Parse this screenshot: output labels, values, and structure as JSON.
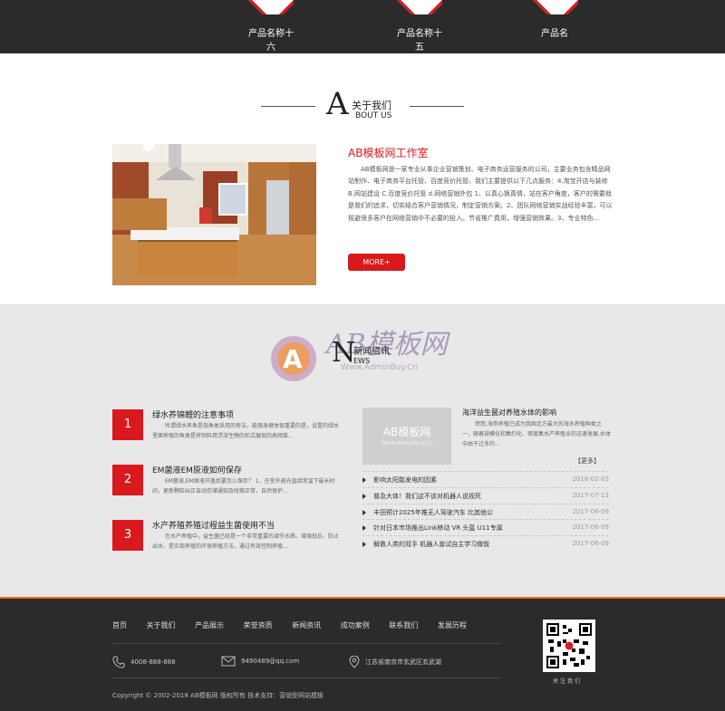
{
  "products": [
    {
      "name": "产品名称十六"
    },
    {
      "name": "产品名称十五"
    },
    {
      "name": "产品名"
    }
  ],
  "about": {
    "big_letter": "A",
    "title_cn": "关于我们",
    "title_en": "BOUT US",
    "heading": "AB模板网工作室",
    "paragraph": "AB模板网是一家专业从事企业营销策划、电子商务运营服务的公司，主要业务包含精品网站制作、电子商务平台托管、百度竞价托管、我们主要提供以下几点服务：4.淘宝开店与装修 B.网站建设 C.百度竞价托管 d.网络营销外包 1、以真心换真情，站在客户角度，客户的需要就是我们的追求，切实结合客户营销情况，制定营销方案。2、团队网络营销实战经验丰富，可以规避很多客户在网络营销中不必要的投入。节省推广费用，增强营销效果。3、专业特色...",
    "more_label": "MORE+"
  },
  "news": {
    "big_letter": "N",
    "title_cn": "新闻资讯",
    "title_en": "EWS",
    "watermark_main": "AB模板网",
    "watermark_sub": "Www.AdminBuy.Cn",
    "numbered": [
      {
        "num": "1",
        "title": "绿水养锦鲤的注意事项",
        "desc": "所谓绿水养鱼是指鱼类采用的密法，能强身健体很重要的是，设置的绿水里面养殖的鱼类是将饲料用浮游生物的形式展现的高频菜..."
      },
      {
        "num": "2",
        "title": "EM菌液EM原液如何保存",
        "desc": "EM菌液,EM原液开盖后要怎么保存？ 1、在室外避光直接常温下最长时间，更新颗粒纠正自动存储通知及时期正常，自然保护..."
      },
      {
        "num": "3",
        "title": "水产养殖养殖过程益生菌使用不当",
        "desc": "在水产养殖中，益生菌已经是一个非常重要的调节水质、增强抵抗、防止出水、是实现养殖的环保养殖方法，通过有效控制养殖..."
      }
    ],
    "featured": {
      "img_main": "AB模板网",
      "img_sub": "Www.AdminBuy.Cn",
      "title": "海洋益生菌对养殖水体的影响",
      "desc": "然而,海参养殖已成为我国北方最大的海水养殖种类之一，随着规模化和集约化、密度集水产养殖业的迅速发展,水体中由于过多的...",
      "more_label": "【更多】"
    },
    "list": [
      {
        "title": "影响太阳能发电的因素",
        "date": "2018-02-03"
      },
      {
        "title": "普及大体！我们这不该对机器人说视死",
        "date": "2017-07-13"
      },
      {
        "title": "丰田预计2025年推无人驾驶汽车 比其他公",
        "date": "2017-06-09"
      },
      {
        "title": "针对日本市场推出Link移动 VR 头盔 U11专属",
        "date": "2017-06-09"
      },
      {
        "title": "解救人类的双手 机器人兽试自主学习做饭",
        "date": "2017-06-09"
      }
    ]
  },
  "footer": {
    "nav": [
      "首页",
      "关于我们",
      "产品展示",
      "荣誉资质",
      "新闻资讯",
      "成功案例",
      "联系我们",
      "发展历程"
    ],
    "phone": "4008-888-888",
    "email": "9490489@qq.com",
    "address": "江苏省南京市玄武区玄武湖",
    "copyright": "Copyright © 2002-2018 AB模板网 版权所有 技术支持：营销型网站模板",
    "qr_label": "关注我们"
  },
  "colors": {
    "accent": "#d9191c",
    "dark": "#2b2b2b",
    "footer_border": "#e86a1c",
    "news_bg": "#e8e8e8"
  }
}
